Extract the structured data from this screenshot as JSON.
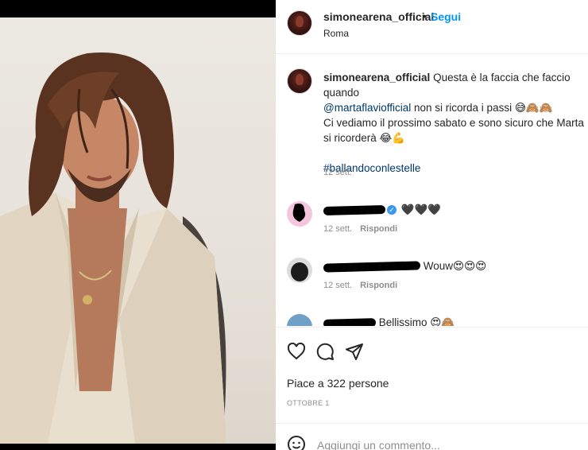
{
  "post": {
    "username": "simonearena_official",
    "separator": "•",
    "follow_label": "Segui",
    "location": "Roma"
  },
  "caption": {
    "username": "simonearena_official",
    "text_1": "Questa è la faccia che faccio quando",
    "mention": "@martaflaviofficial",
    "text_2": "non si ricorda i passi 😅🙈🙈",
    "text_3": "Ci vediamo il prossimo sabato e sono sicuro che Marta si ricorderà 😂💪",
    "hashtag": "#ballandoconlestelle",
    "time": "12 sett."
  },
  "comments": [
    {
      "username": "michelle_ ____",
      "text": "🖤🖤🖤",
      "time": "12 sett.",
      "reply_label": "Rispondi"
    },
    {
      "username": "j____________",
      "text": "Wouw😍😍😍",
      "time": "12 sett.",
      "reply_label": "Rispondi"
    },
    {
      "username": "__________",
      "text": "Bellissimo 😍🙈",
      "time": "",
      "reply_label": ""
    }
  ],
  "actions": {
    "likes": "Piace a 322 persone",
    "date": "OTTOBRE 1"
  },
  "add_comment": {
    "placeholder": "Aggiungi un commento..."
  },
  "icons": {
    "like": "heart-icon",
    "comment": "comment-icon",
    "share": "paper-plane-icon",
    "emoji": "emoji-icon",
    "verified": "verified-badge-icon"
  },
  "colors": {
    "link_blue": "#0095f6",
    "mention_blue": "#00376b",
    "text": "#262626",
    "muted": "#8e8e8e"
  }
}
